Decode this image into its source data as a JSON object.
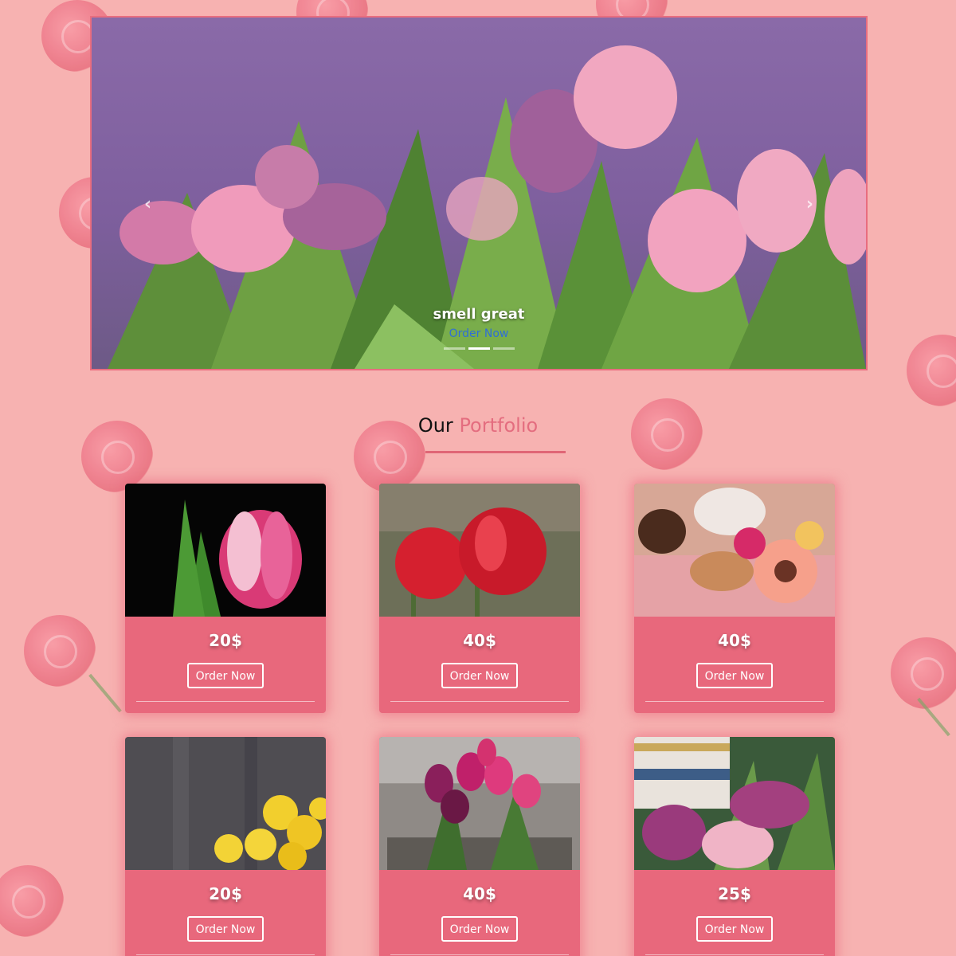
{
  "carousel": {
    "caption_title": "smell great",
    "caption_link": "Order Now",
    "prev_glyph": "‹",
    "next_glyph": "›",
    "slide_count": 3,
    "active_slide": 2
  },
  "portfolio": {
    "title_main": "Our",
    "title_accent": "Portfolio",
    "cards": [
      {
        "price": "20$",
        "button": "Order Now",
        "image": "pink-tulip-black-bg"
      },
      {
        "price": "40$",
        "button": "Order Now",
        "image": "red-tulips-pair"
      },
      {
        "price": "40$",
        "button": "Order Now",
        "image": "gerbera-breakfast-tray"
      },
      {
        "price": "20$",
        "button": "Order Now",
        "image": "yellow-buttercups-wood"
      },
      {
        "price": "40$",
        "button": "Order Now",
        "image": "purple-tulip-bouquet"
      },
      {
        "price": "25$",
        "button": "Order Now",
        "image": "tulips-teacup"
      }
    ]
  },
  "colors": {
    "page_background": "#f7b2b1",
    "card_background": "#e8687c",
    "accent": "#e46d7f",
    "link": "#2f6fd6"
  }
}
